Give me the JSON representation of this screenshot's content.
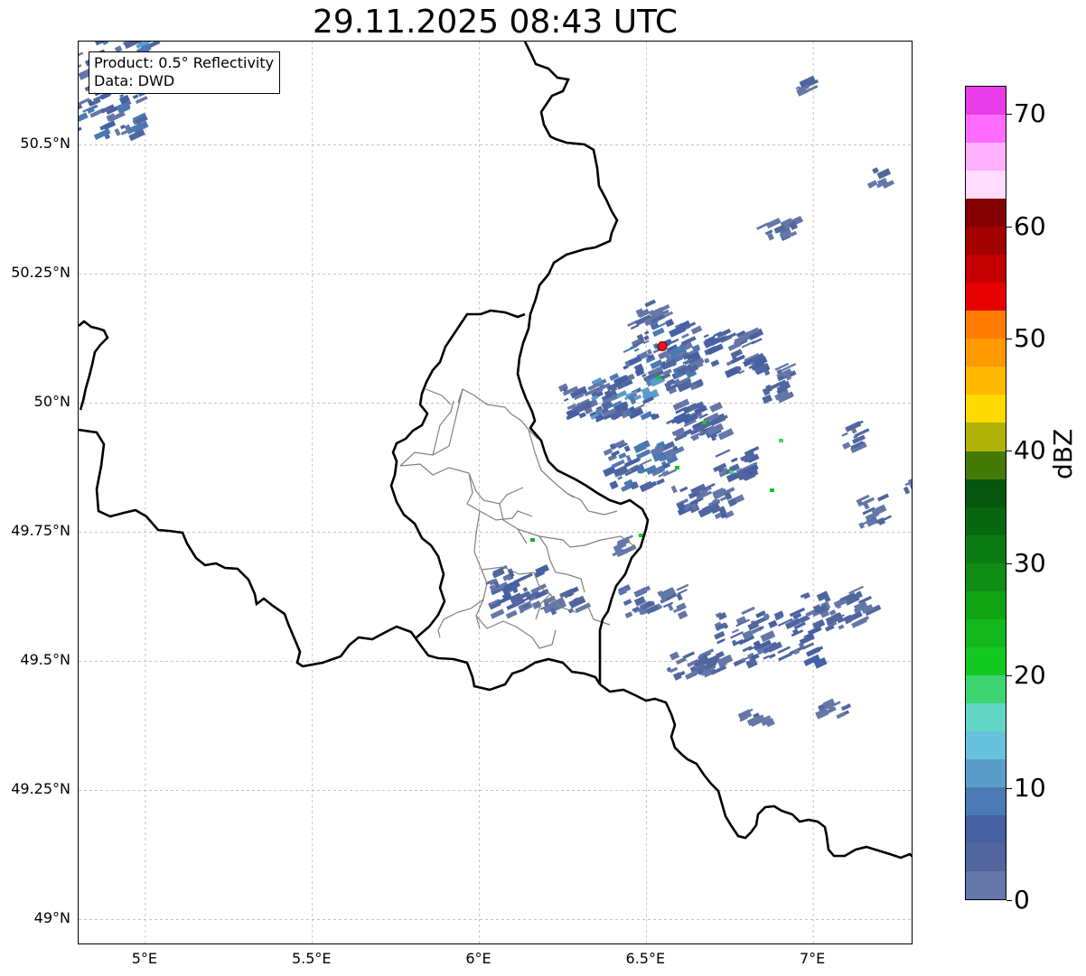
{
  "title": "29.11.2025 08:43 UTC",
  "info": {
    "product": "Product: 0.5° Reflectivity",
    "source": "Data: DWD"
  },
  "map": {
    "lon_range": [
      4.8,
      7.3
    ],
    "lat_range": [
      48.95,
      50.7
    ],
    "lon_ticks": [
      {
        "value": 5.0,
        "label": "5°E"
      },
      {
        "value": 5.5,
        "label": "5.5°E"
      },
      {
        "value": 6.0,
        "label": "6°E"
      },
      {
        "value": 6.5,
        "label": "6.5°E"
      },
      {
        "value": 7.0,
        "label": "7°E"
      }
    ],
    "lat_ticks": [
      {
        "value": 49.0,
        "label": "49°N"
      },
      {
        "value": 49.25,
        "label": "49.25°N"
      },
      {
        "value": 49.5,
        "label": "49.5°N"
      },
      {
        "value": 49.75,
        "label": "49.75°N"
      },
      {
        "value": 50.0,
        "label": "50°N"
      },
      {
        "value": 50.25,
        "label": "50.25°N"
      },
      {
        "value": 50.5,
        "label": "50.5°N"
      }
    ],
    "grid": true,
    "radar_site": {
      "lon": 6.548,
      "lat": 50.11,
      "color": "#e8161b"
    },
    "border_color": "#000000",
    "admin_border_color": "#808080"
  },
  "colorbar": {
    "unit": "dBZ",
    "min": 0,
    "max": 70,
    "step": 2.5,
    "ticks": [
      {
        "value": 0,
        "label": "0"
      },
      {
        "value": 10,
        "label": "10"
      },
      {
        "value": 20,
        "label": "20"
      },
      {
        "value": 30,
        "label": "30"
      },
      {
        "value": 40,
        "label": "40"
      },
      {
        "value": 50,
        "label": "50"
      },
      {
        "value": 60,
        "label": "60"
      },
      {
        "value": 70,
        "label": "70"
      }
    ],
    "colors": [
      "#6577a8",
      "#51669f",
      "#4660a3",
      "#4b79b3",
      "#5b9dc9",
      "#67c2dd",
      "#62d6c6",
      "#3dd472",
      "#13c91f",
      "#12b81b",
      "#10a314",
      "#0f8c14",
      "#0c7a12",
      "#086711",
      "#07560e",
      "#467a07",
      "#b1b207",
      "#ffd900",
      "#ffb800",
      "#ff9a00",
      "#ff7c00",
      "#e60000",
      "#c20000",
      "#a30000",
      "#820000",
      "#ffdcff",
      "#ffb0ff",
      "#ff6cff",
      "#e83ce8"
    ]
  }
}
